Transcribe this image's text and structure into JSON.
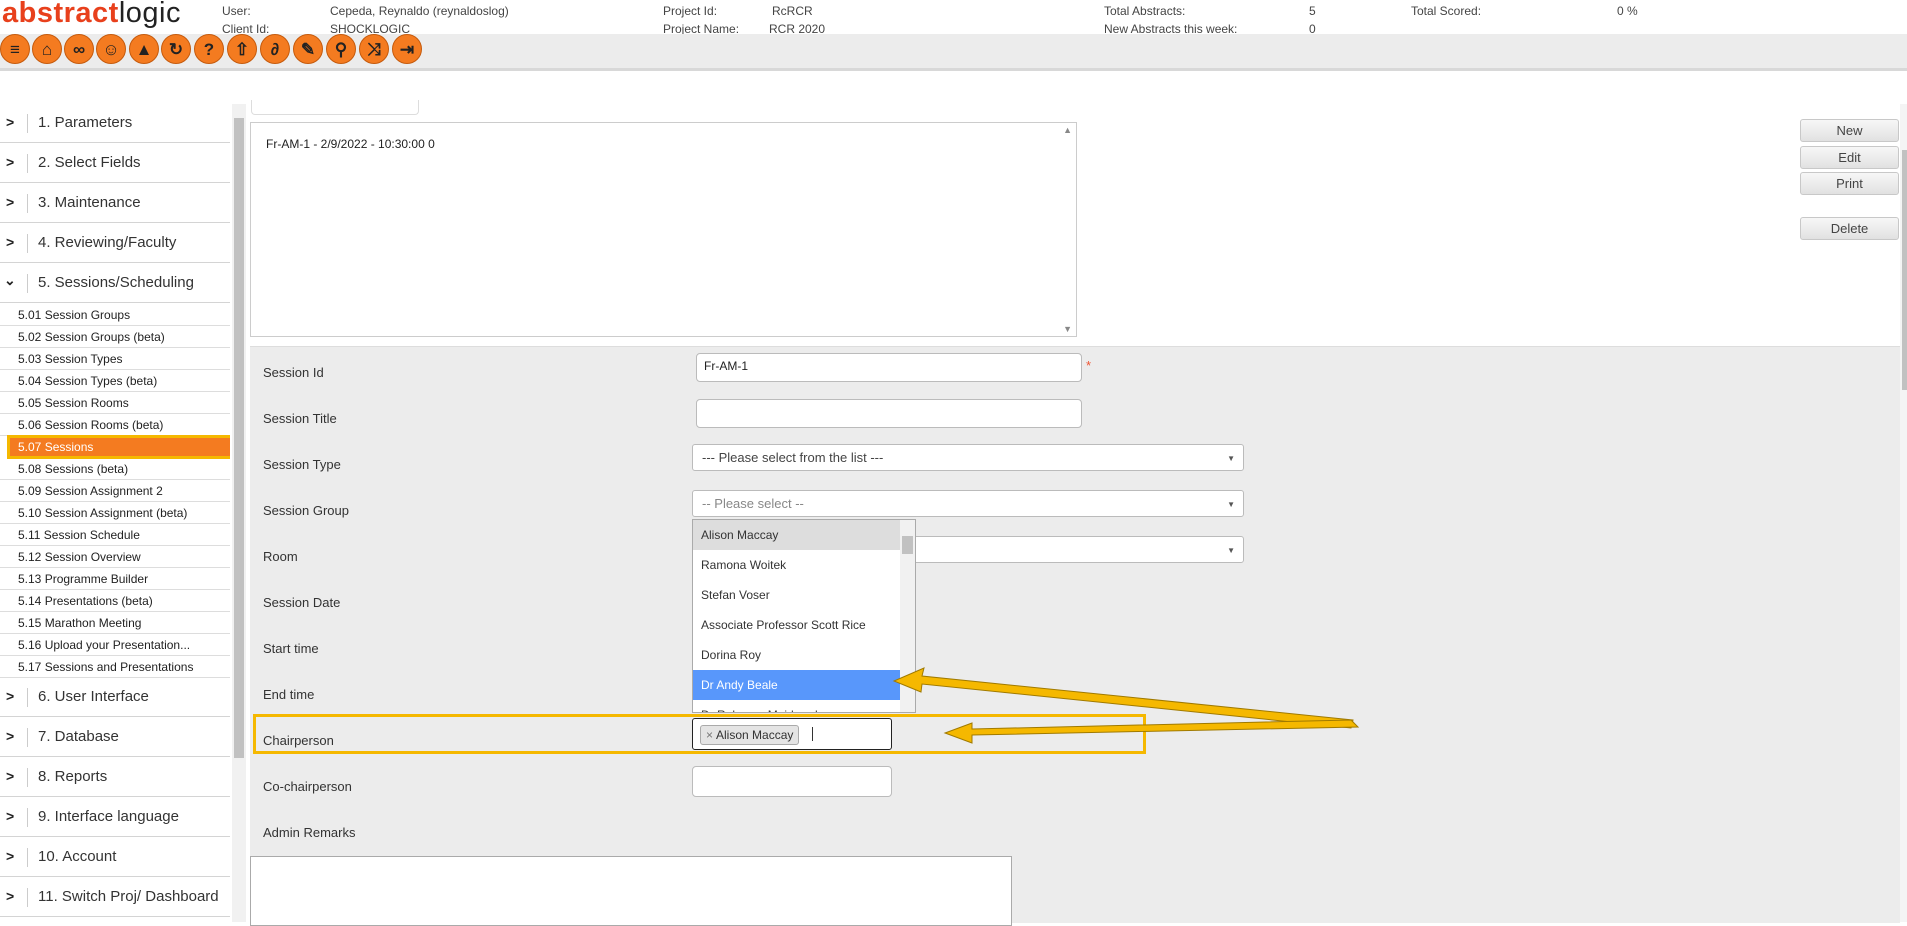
{
  "header": {
    "logo_part1": "abstract",
    "logo_part2": "logic",
    "user_label": "User:",
    "user_value": "Cepeda, Reynaldo (reynaldoslog)",
    "client_label": "Client Id:",
    "client_value": "SHOCKLOGIC",
    "project_id_label": "Project Id:",
    "project_id_value": "RcRCR",
    "project_name_label": "Project Name:",
    "project_name_value": "RCR 2020",
    "total_abstracts_label": "Total Abstracts:",
    "total_abstracts_value": "5",
    "new_abstracts_label": "New Abstracts this week:",
    "new_abstracts_value": "0",
    "total_scored_label": "Total Scored:",
    "total_scored_value": "0 %"
  },
  "toolbar": {
    "icons": [
      "menu-icon",
      "home-icon",
      "binoculars-icon",
      "users-icon",
      "mountain-icon",
      "refresh-icon",
      "help-icon",
      "upload-icon",
      "link-icon",
      "edit-icon",
      "search-icon",
      "shuffle-icon",
      "logout-icon"
    ],
    "accent": "#f47b20"
  },
  "sidebar": {
    "sections_top": [
      {
        "label": "1. Parameters"
      },
      {
        "label": "2. Select Fields"
      },
      {
        "label": "3. Maintenance"
      },
      {
        "label": "4. Reviewing/Faculty"
      },
      {
        "label": "5. Sessions/Scheduling"
      }
    ],
    "subitems": [
      {
        "label": "5.01 Session Groups"
      },
      {
        "label": "5.02 Session Groups (beta)"
      },
      {
        "label": "5.03 Session Types"
      },
      {
        "label": "5.04 Session Types (beta)"
      },
      {
        "label": "5.05 Session Rooms"
      },
      {
        "label": "5.06 Session Rooms (beta)"
      },
      {
        "label": "5.07 Sessions"
      },
      {
        "label": "5.08 Sessions (beta)"
      },
      {
        "label": "5.09 Session Assignment 2"
      },
      {
        "label": "5.10 Session Assignment (beta)"
      },
      {
        "label": "5.11 Session Schedule"
      },
      {
        "label": "5.12 Session Overview"
      },
      {
        "label": "5.13 Programme Builder"
      },
      {
        "label": "5.14 Presentations (beta)"
      },
      {
        "label": "5.15 Marathon Meeting"
      },
      {
        "label": "5.16 Upload your Presentation..."
      },
      {
        "label": "5.17 Sessions and Presentations"
      }
    ],
    "sections_bottom": [
      {
        "label": "6. User Interface"
      },
      {
        "label": "7. Database"
      },
      {
        "label": "8. Reports"
      },
      {
        "label": "9. Interface language"
      },
      {
        "label": "10. Account"
      },
      {
        "label": "11. Switch Proj/ Dashboard"
      }
    ],
    "active_item": "5.07 Sessions",
    "expanded_section": "5. Sessions/Scheduling"
  },
  "session_list": {
    "items": [
      "Fr-AM-1 - 2/9/2022 - 10:30:00 0"
    ]
  },
  "actions": {
    "new": "New",
    "edit": "Edit",
    "print": "Print",
    "delete": "Delete"
  },
  "form": {
    "session_id_label": "Session Id",
    "session_id_value": "Fr-AM-1",
    "required_mark": "*",
    "session_title_label": "Session Title",
    "session_title_value": "",
    "session_type_label": "Session Type",
    "session_type_value": "--- Please select from the list ---",
    "session_group_label": "Session Group",
    "session_group_value": "-- Please select --",
    "room_label": "Room",
    "session_date_label": "Session Date",
    "start_time_label": "Start time",
    "end_time_label": "End time",
    "chairperson_label": "Chairperson",
    "chairperson_selected": "Alison Maccay",
    "chip_remove": "×",
    "cochair_label": "Co-chairperson",
    "admin_remarks_label": "Admin Remarks"
  },
  "chair_dropdown": {
    "options": [
      "Alison Maccay",
      "Ramona Woitek",
      "Stefan Voser",
      "Associate Professor Scott Rice",
      "Dorina Roy",
      "Dr Andy Beale",
      "Dr Rebecca Muirhead"
    ],
    "highlighted": "Dr Andy Beale",
    "highlight_color": "#5897fb"
  },
  "annotation": {
    "color": "#f5b800"
  }
}
